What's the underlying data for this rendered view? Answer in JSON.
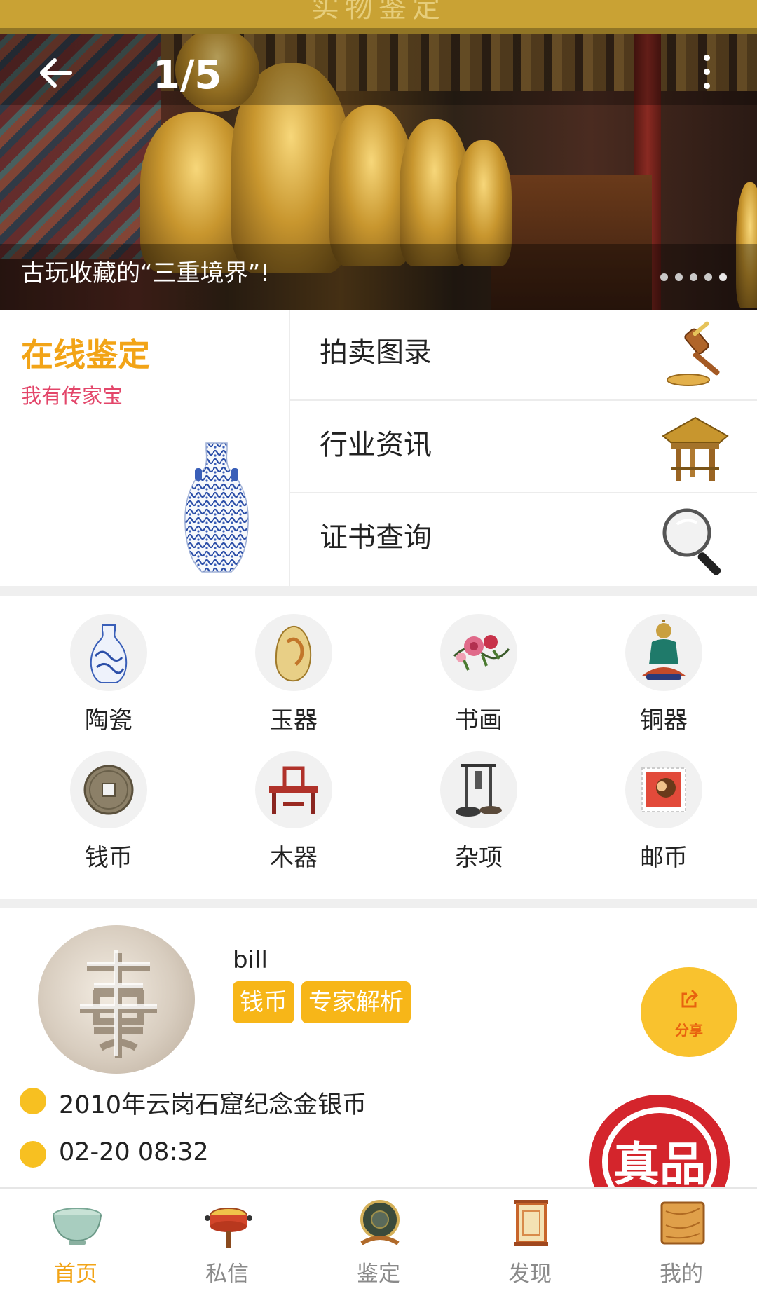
{
  "banner": {
    "header_ghost_title": "实物鉴定",
    "back_icon": "arrow-left-icon",
    "counter": "1/5",
    "more_icon": "more-vertical-icon",
    "caption": "古玩收藏的“三重境界”!",
    "slide_count": 5,
    "active_slide": 1
  },
  "feature": {
    "online_title": "在线鉴定",
    "online_subtitle": "我有传家宝",
    "menu": [
      {
        "label": "拍卖图录",
        "icon": "gavel-icon"
      },
      {
        "label": "行业资讯",
        "icon": "pavilion-icon"
      },
      {
        "label": "证书查询",
        "icon": "magnifier-icon"
      }
    ]
  },
  "categories": [
    {
      "label": "陶瓷",
      "icon": "porcelain-vase-icon"
    },
    {
      "label": "玉器",
      "icon": "jade-icon"
    },
    {
      "label": "书画",
      "icon": "painting-icon"
    },
    {
      "label": "铜器",
      "icon": "bronze-buddha-icon"
    },
    {
      "label": "钱币",
      "icon": "coin-icon"
    },
    {
      "label": "木器",
      "icon": "wood-furniture-icon"
    },
    {
      "label": "杂项",
      "icon": "misc-items-icon"
    },
    {
      "label": "邮币",
      "icon": "stamp-icon"
    }
  ],
  "post": {
    "username": "bill",
    "tags": [
      "钱币",
      "专家解析"
    ],
    "share_label": "分享",
    "title": "2010年云岗石窟纪念金银币",
    "time": "02-20 08:32",
    "stamp_text": "真品"
  },
  "nav": [
    {
      "label": "首页",
      "icon": "bowl-icon",
      "active": true
    },
    {
      "label": "私信",
      "icon": "drum-icon",
      "active": false
    },
    {
      "label": "鉴定",
      "icon": "mirror-stand-icon",
      "active": false
    },
    {
      "label": "发现",
      "icon": "lantern-icon",
      "active": false
    },
    {
      "label": "我的",
      "icon": "wood-box-icon",
      "active": false
    }
  ],
  "colors": {
    "accent_orange": "#f2a417",
    "tag_yellow": "#f7b618",
    "subtitle_red": "#e3466a",
    "stamp_red": "#d4252c"
  }
}
